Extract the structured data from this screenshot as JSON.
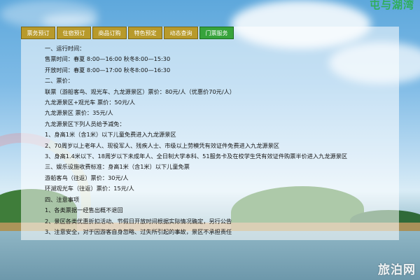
{
  "brand": "屯与湖湾",
  "tabs": [
    {
      "label": "票务预订",
      "active": false
    },
    {
      "label": "住宿预订",
      "active": false
    },
    {
      "label": "商品订购",
      "active": false
    },
    {
      "label": "特色预定",
      "active": false
    },
    {
      "label": "动态查询",
      "active": false
    },
    {
      "label": "门票服务",
      "active": true
    }
  ],
  "content": [
    "一、运行时间：",
    "售票时间：春夏 8:00—16:00 秋冬8:00—15:30",
    "开放时间：春夏 8:00—17:00 秋冬8:00—16:30",
    "二、票价：",
    "联票（游船客鸟、观光车、九龙源景区）票价：80元/人（优惠价70元/人）",
    "九龙源景区+观光车 票价：50元/人",
    "九龙源景区 票价：35元/人",
    "九龙源景区下列人员给予减免：",
    "1、身高1米（含1米）以下儿童免费进入九龙源景区",
    "2、70周岁以上老年人、现役军人、残疾人士、市级以上劳模凭有效证件免费进入九龙源景区",
    "3、身高1.4米以下、18周岁以下未成年人、全日制大学本科、51服务卡及在校学生凭有效证件购票半价进入九龙源景区",
    "三、娱乐设施收费标准：身高1米（含1米）以下儿童免票",
    "游船客鸟（往返）票价：30元/人",
    "环湖观光车（往返）票价：15元/人",
    "四、注意事项",
    "1、各类票据一经售出概不退回",
    "2、景区各类优惠折扣活动、节假日开放时间根据实际情况确定，另行公告",
    "3、注意安全，对于因游客自身忽略、过失所引起的事故，景区不承担责任"
  ],
  "watermark": "旅泊网"
}
